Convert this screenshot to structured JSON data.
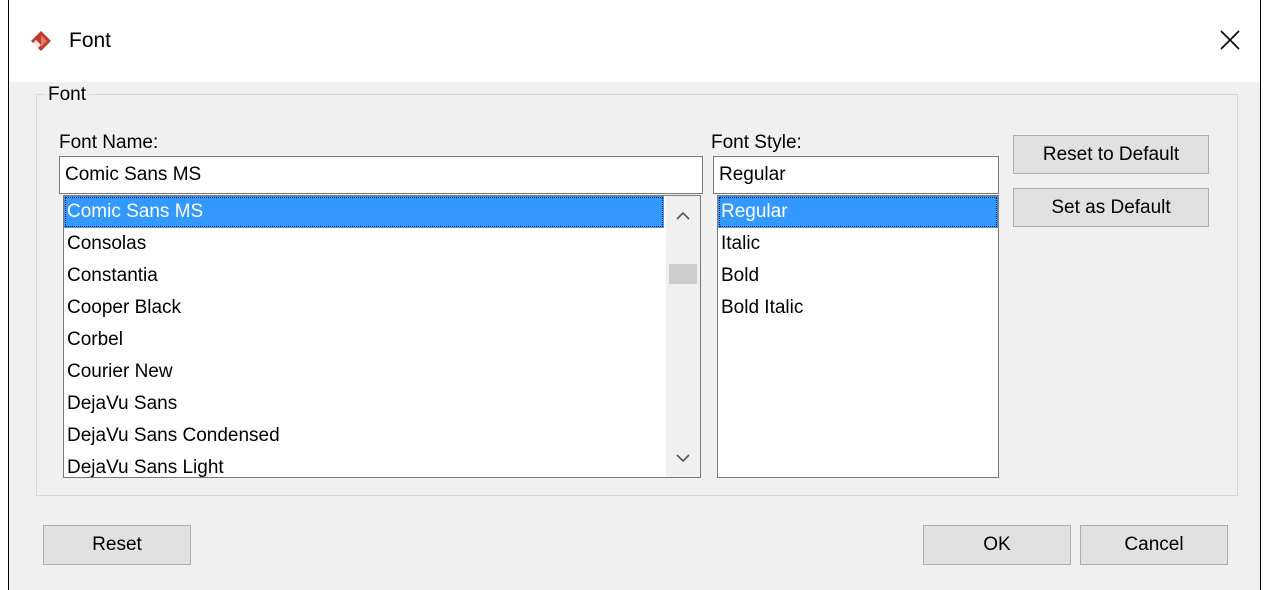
{
  "window": {
    "title": "Font"
  },
  "group": {
    "title": "Font"
  },
  "font_name": {
    "label": "Font Name:",
    "value": "Comic Sans MS",
    "items": [
      "Comic Sans MS",
      "Consolas",
      "Constantia",
      "Cooper Black",
      "Corbel",
      "Courier New",
      "DejaVu Sans",
      "DejaVu Sans Condensed",
      "DejaVu Sans Light"
    ],
    "selected_index": 0
  },
  "font_style": {
    "label": "Font Style:",
    "value": "Regular",
    "items": [
      "Regular",
      "Italic",
      "Bold",
      "Bold Italic"
    ],
    "selected_index": 0
  },
  "buttons": {
    "reset_to_default": "Reset to Default",
    "set_as_default": "Set as Default",
    "reset": "Reset",
    "ok": "OK",
    "cancel": "Cancel"
  },
  "colors": {
    "selection": "#3399ff",
    "app_icon": "#c0392b"
  },
  "icons": {
    "app": "app-logo-icon",
    "close": "close-icon",
    "scroll_up": "chevron-up-icon",
    "scroll_down": "chevron-down-icon"
  }
}
